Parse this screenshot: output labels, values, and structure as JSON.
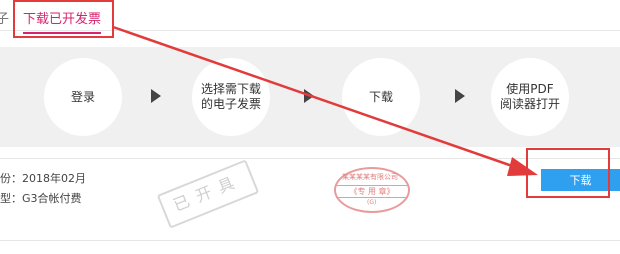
{
  "tabs": {
    "left_edge_fragment": "子",
    "active_label": "下载已开发票"
  },
  "steps": [
    {
      "label": "登录"
    },
    {
      "label": "选择需下载\n的电子发票"
    },
    {
      "label": "下载"
    },
    {
      "label": "使用PDF\n阅读器打开"
    }
  ],
  "invoice": {
    "period_line": "份：2018年02月",
    "type_line": "型：G3合帐付费",
    "stamp_text": "已开具",
    "seal_top_text": "某某某某有限公司",
    "seal_mid_text": "《专 用 章》",
    "seal_bottom_text": "(G)",
    "download_label": "下载"
  },
  "colors": {
    "accent_pink": "#d6246e",
    "annotation_red": "#e23b3b",
    "button_blue": "#2f9ff0",
    "band_gray": "#f0f0f0"
  }
}
